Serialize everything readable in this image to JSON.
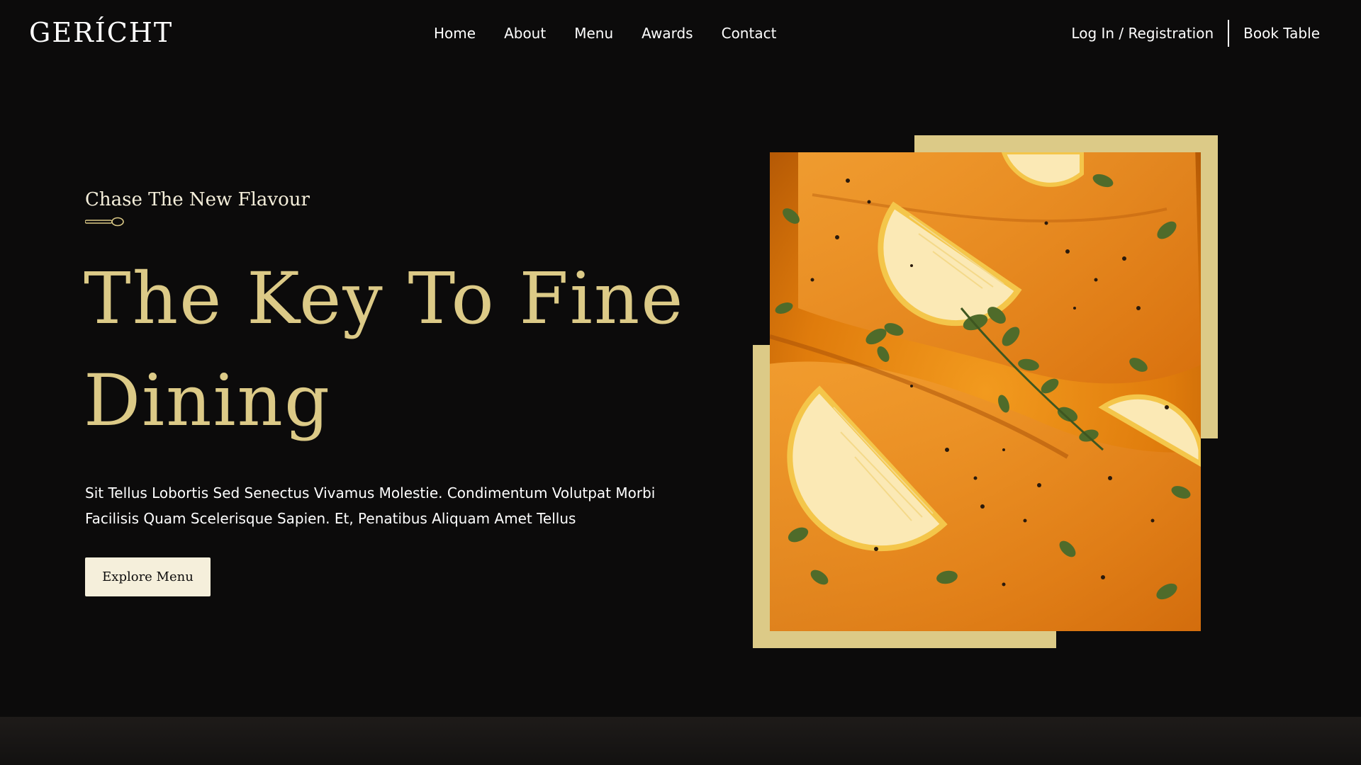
{
  "brand": {
    "logo": "GERÍCHT",
    "accent_color": "#dcca87",
    "cream_color": "#f5efdb",
    "background_color": "#0c0b0b"
  },
  "nav": {
    "links": [
      "Home",
      "About",
      "Menu",
      "Awards",
      "Contact"
    ],
    "login": "Log In / Registration",
    "book": "Book Table"
  },
  "hero": {
    "subtitle": "Chase The New Flavour",
    "subtitle_icon": "spoon-icon",
    "headline_line1": "The Key To Fine",
    "headline_line2": "Dining",
    "description_line1": "Sit Tellus Lobortis Sed Senectus Vivamus Molestie. Condimentum Volutpat Morbi",
    "description_line2": "Facilisis Quam Scelerisque Sapien. Et, Penatibus Aliquam Amet Tellus",
    "button_label": "Explore Menu"
  }
}
